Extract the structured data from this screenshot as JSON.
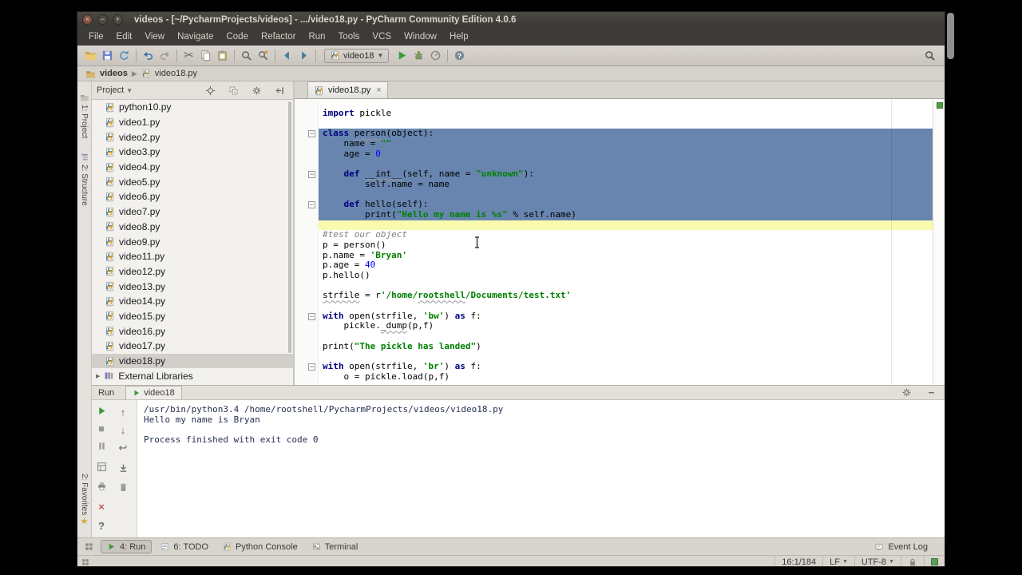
{
  "colors": {
    "selection_background": "#6785AF",
    "current_line_background": "#F9FAAE",
    "keyword": "#000080",
    "string": "#008000",
    "number": "#0000FF",
    "comment": "#808080",
    "run_green": "#3B9A3B",
    "close_red": "#C75450",
    "inspection_indicator_green": "#4CA03C"
  },
  "title_bar": {
    "title": "videos - [~/PycharmProjects/videos] - .../video18.py - PyCharm Community Edition 4.0.6"
  },
  "menu": {
    "items": [
      "File",
      "Edit",
      "View",
      "Navigate",
      "Code",
      "Refactor",
      "Run",
      "Tools",
      "VCS",
      "Window",
      "Help"
    ]
  },
  "toolbar": {
    "icons": [
      "open-folder",
      "save-all",
      "synchronize",
      "sep",
      "undo",
      "redo",
      "sep",
      "cut",
      "copy",
      "paste",
      "sep",
      "find",
      "replace",
      "sep",
      "back",
      "forward",
      "sep"
    ],
    "run_config": "video18",
    "after_icons": [
      "run-play",
      "debug-bug",
      "coverage",
      "sep",
      "help"
    ],
    "right_icon": "search-everywhere"
  },
  "navbar": {
    "crumbs": [
      "videos",
      "video18.py"
    ]
  },
  "side_tabs": {
    "top": [
      {
        "label": "1: Project",
        "icon": "proj-tab"
      },
      {
        "label": "2: Structure",
        "icon": "struct-tab"
      }
    ],
    "bottom": [
      {
        "label": "2: Favorites",
        "icon": "star"
      }
    ]
  },
  "project_panel": {
    "header": "Project",
    "header_icons": [
      "locate",
      "collapse-all",
      "settings-gear",
      "hide-panel"
    ],
    "files": [
      "python10.py",
      "video1.py",
      "video2.py",
      "video3.py",
      "video4.py",
      "video5.py",
      "video6.py",
      "video7.py",
      "video8.py",
      "video9.py",
      "video11.py",
      "video12.py",
      "video13.py",
      "video14.py",
      "video15.py",
      "video16.py",
      "video17.py",
      "video18.py"
    ],
    "selected_file": "video18.py",
    "external_libraries": "External Libraries"
  },
  "editor": {
    "tab": "video18.py",
    "fold_lines": [
      2,
      6,
      9,
      20,
      25
    ],
    "lines": [
      {
        "tokens": [
          [
            "k",
            "import"
          ],
          [
            "p",
            " pickle"
          ]
        ]
      },
      {
        "tokens": []
      },
      {
        "selected": true,
        "tokens": [
          [
            "k",
            "class"
          ],
          [
            "p",
            " "
          ],
          [
            "pu",
            "person"
          ],
          [
            "p",
            "(object):"
          ]
        ]
      },
      {
        "selected": true,
        "tokens": [
          [
            "p",
            "    name = "
          ],
          [
            "s",
            "\"\""
          ]
        ]
      },
      {
        "selected": true,
        "tokens": [
          [
            "p",
            "    age = "
          ],
          [
            "n",
            "0"
          ]
        ]
      },
      {
        "selected": true,
        "tokens": []
      },
      {
        "selected": true,
        "tokens": [
          [
            "p",
            "    "
          ],
          [
            "k",
            "def"
          ],
          [
            "p",
            " "
          ],
          [
            "pu",
            "__int__"
          ],
          [
            "p",
            "(self, name = "
          ],
          [
            "s",
            "\"unknown\""
          ],
          [
            "p",
            "):"
          ]
        ]
      },
      {
        "selected": true,
        "tokens": [
          [
            "p",
            "        self.name = name"
          ]
        ]
      },
      {
        "selected": true,
        "tokens": []
      },
      {
        "selected": true,
        "tokens": [
          [
            "p",
            "    "
          ],
          [
            "k",
            "def"
          ],
          [
            "p",
            " hello(self):"
          ]
        ]
      },
      {
        "selected": true,
        "tokens": [
          [
            "p",
            "        print("
          ],
          [
            "s",
            "\"Hello my name is %s\""
          ],
          [
            "p",
            " % self.name)"
          ]
        ]
      },
      {
        "current": true,
        "tokens": []
      },
      {
        "tokens": [
          [
            "c",
            "#test our object"
          ]
        ]
      },
      {
        "tokens": [
          [
            "p",
            "p = person()"
          ]
        ]
      },
      {
        "tokens": [
          [
            "p",
            "p.name = "
          ],
          [
            "s",
            "'Bryan'"
          ]
        ]
      },
      {
        "tokens": [
          [
            "p",
            "p.age = "
          ],
          [
            "n",
            "40"
          ]
        ]
      },
      {
        "tokens": [
          [
            "p",
            "p.hello()"
          ]
        ]
      },
      {
        "tokens": []
      },
      {
        "tokens": [
          [
            "pu",
            "strfile"
          ],
          [
            "p",
            " = r"
          ],
          [
            "s",
            "'/home/"
          ],
          [
            "su",
            "rootshell"
          ],
          [
            "s",
            "/Documents/test.txt'"
          ]
        ]
      },
      {
        "tokens": []
      },
      {
        "tokens": [
          [
            "k",
            "with"
          ],
          [
            "p",
            " open(strfile, "
          ],
          [
            "s",
            "'bw'"
          ],
          [
            "p",
            ") "
          ],
          [
            "k",
            "as"
          ],
          [
            "p",
            " f:"
          ]
        ]
      },
      {
        "tokens": [
          [
            "p",
            "    pickle."
          ],
          [
            "pu",
            "_dump"
          ],
          [
            "p",
            "(p,f)"
          ]
        ]
      },
      {
        "tokens": []
      },
      {
        "tokens": [
          [
            "p",
            "print("
          ],
          [
            "s",
            "\"The pickle has landed\""
          ],
          [
            "p",
            ")"
          ]
        ]
      },
      {
        "tokens": []
      },
      {
        "tokens": [
          [
            "k",
            "with"
          ],
          [
            "p",
            " open(strfile, "
          ],
          [
            "s",
            "'br'"
          ],
          [
            "p",
            ") "
          ],
          [
            "k",
            "as"
          ],
          [
            "p",
            " f:"
          ]
        ]
      },
      {
        "tokens": [
          [
            "p",
            "    o = pickle.load(p,f)"
          ]
        ]
      }
    ]
  },
  "run_panel": {
    "label": "Run",
    "tab": "video18",
    "header_icons": [
      "settings-gear",
      "minimize"
    ],
    "left_icons_col1": [
      "rerun",
      "stop",
      "pause",
      "restore-layout",
      "printer",
      "close-x",
      "question"
    ],
    "left_icons_col2": [
      "up-stack",
      "down-stack",
      "soft-wrap",
      "scroll-end",
      "clear-all"
    ],
    "output": [
      "/usr/bin/python3.4 /home/rootshell/PycharmProjects/videos/video18.py",
      "Hello my name is Bryan",
      "",
      "Process finished with exit code 0"
    ]
  },
  "bottom_bar": {
    "left": [
      {
        "label": "4: Run",
        "icon": "run-play",
        "active": true
      },
      {
        "label": "6: TODO",
        "icon": "todo",
        "active": false
      },
      {
        "label": "Python Console",
        "icon": "py-file",
        "active": false
      },
      {
        "label": "Terminal",
        "icon": "terminal",
        "active": false
      }
    ],
    "right": [
      {
        "label": "Event Log",
        "icon": "event-log",
        "active": false
      }
    ]
  },
  "status_bar": {
    "position": "16:1/184",
    "line_sep": "LF",
    "encoding": "UTF-8"
  }
}
